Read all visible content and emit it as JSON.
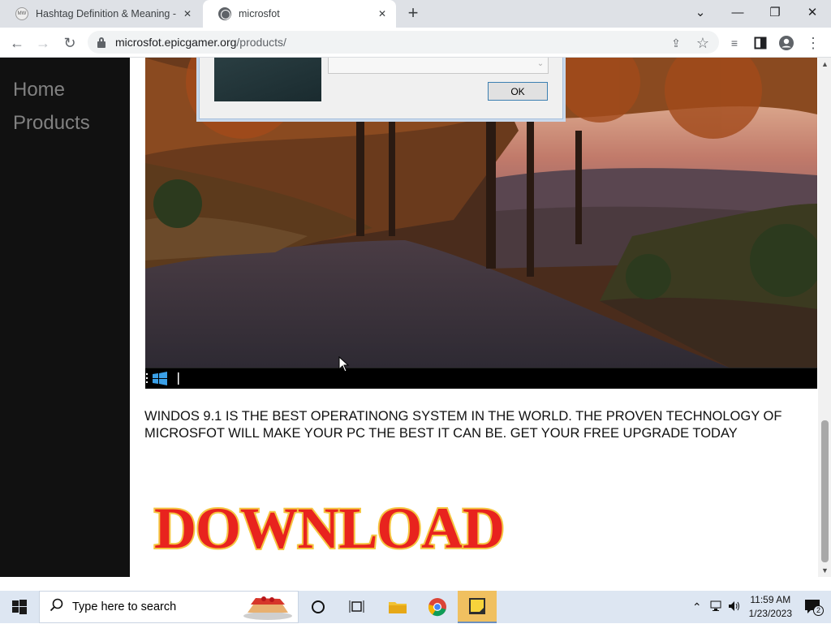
{
  "browser": {
    "tabs": [
      {
        "title": "Hashtag Definition & Meaning -",
        "favicon": "MW"
      },
      {
        "title": "microsfot"
      }
    ],
    "url_host": "microsfot.epicgamer.org",
    "url_path": "/products/"
  },
  "sidebar": {
    "items": [
      {
        "label": "Home"
      },
      {
        "label": "Products"
      }
    ]
  },
  "dialog": {
    "ok_label": "OK"
  },
  "main": {
    "copy": "WINDOS 9.1 IS THE BEST OPERATINONG SYSTEM IN THE WORLD. THE PROVEN TECHNOLOGY OF MICROSFOT WILL MAKE YOUR PC THE BEST IT CAN BE. GET YOUR FREE UPGRADE TODAY",
    "download_label": "DOWNLOAD"
  },
  "taskbar": {
    "search_placeholder": "Type here to search",
    "time": "11:59 AM",
    "date": "1/23/2023",
    "notification_count": "2"
  },
  "colors": {
    "sidebar_bg": "#111111",
    "nav_text": "#818181",
    "download_fill": "#e8231e",
    "download_stroke": "#f5c542"
  }
}
